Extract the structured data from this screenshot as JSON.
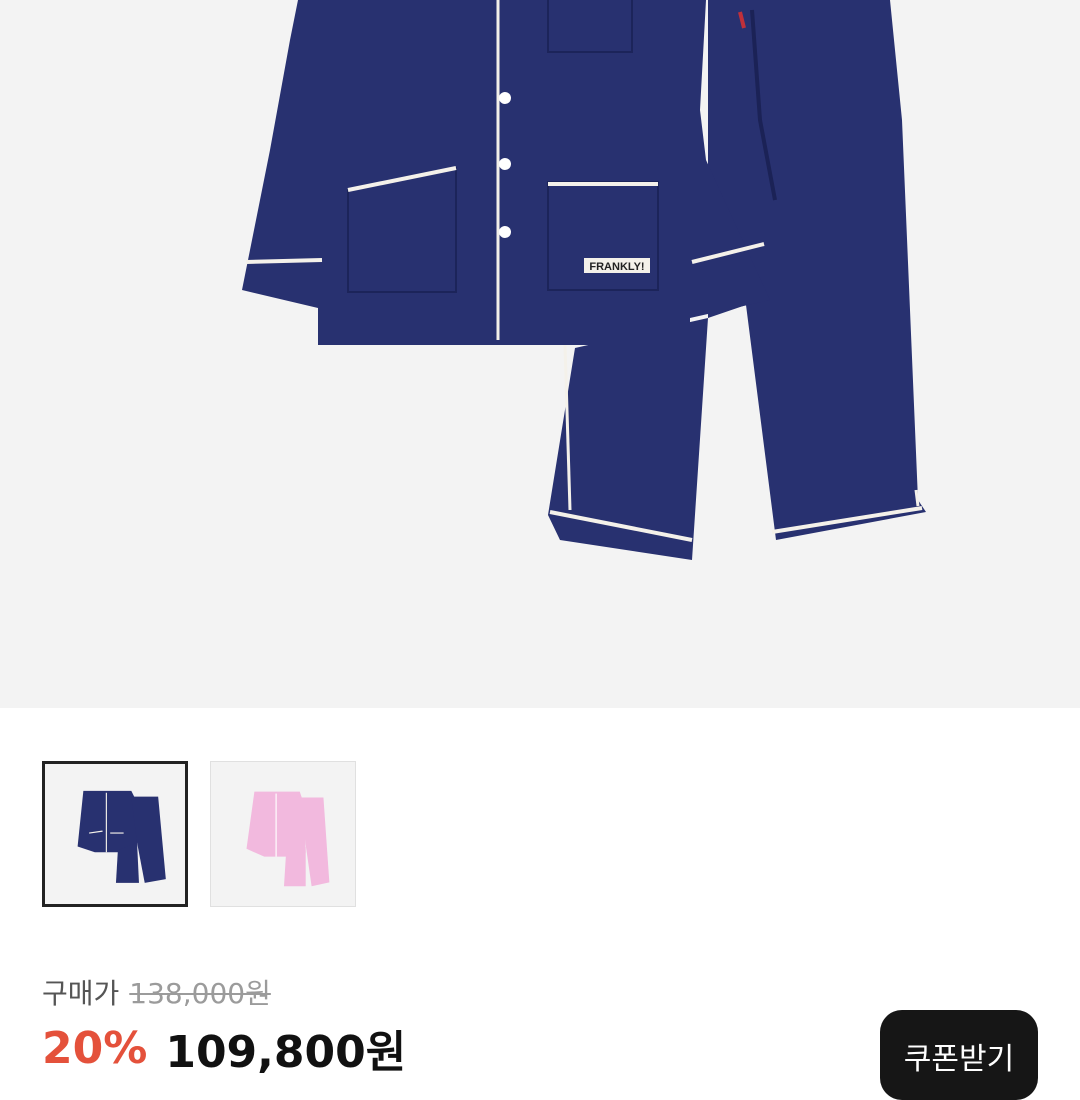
{
  "product": {
    "main_image_alt": "네이비 새틴 파자마 세트",
    "label_text": "FRANKLY!",
    "colors": {
      "navy": "#283170",
      "pink": "#f2b9de",
      "piping": "#f4f1ea",
      "background": "#f3f3f3"
    }
  },
  "thumbnails": [
    {
      "name": "navy",
      "selected": true
    },
    {
      "name": "pink",
      "selected": false
    }
  ],
  "price": {
    "label": "구매가",
    "original": "138,000원",
    "discount": "20%",
    "sale": "109,800원"
  },
  "coupon": {
    "button_label": "쿠폰받기"
  }
}
